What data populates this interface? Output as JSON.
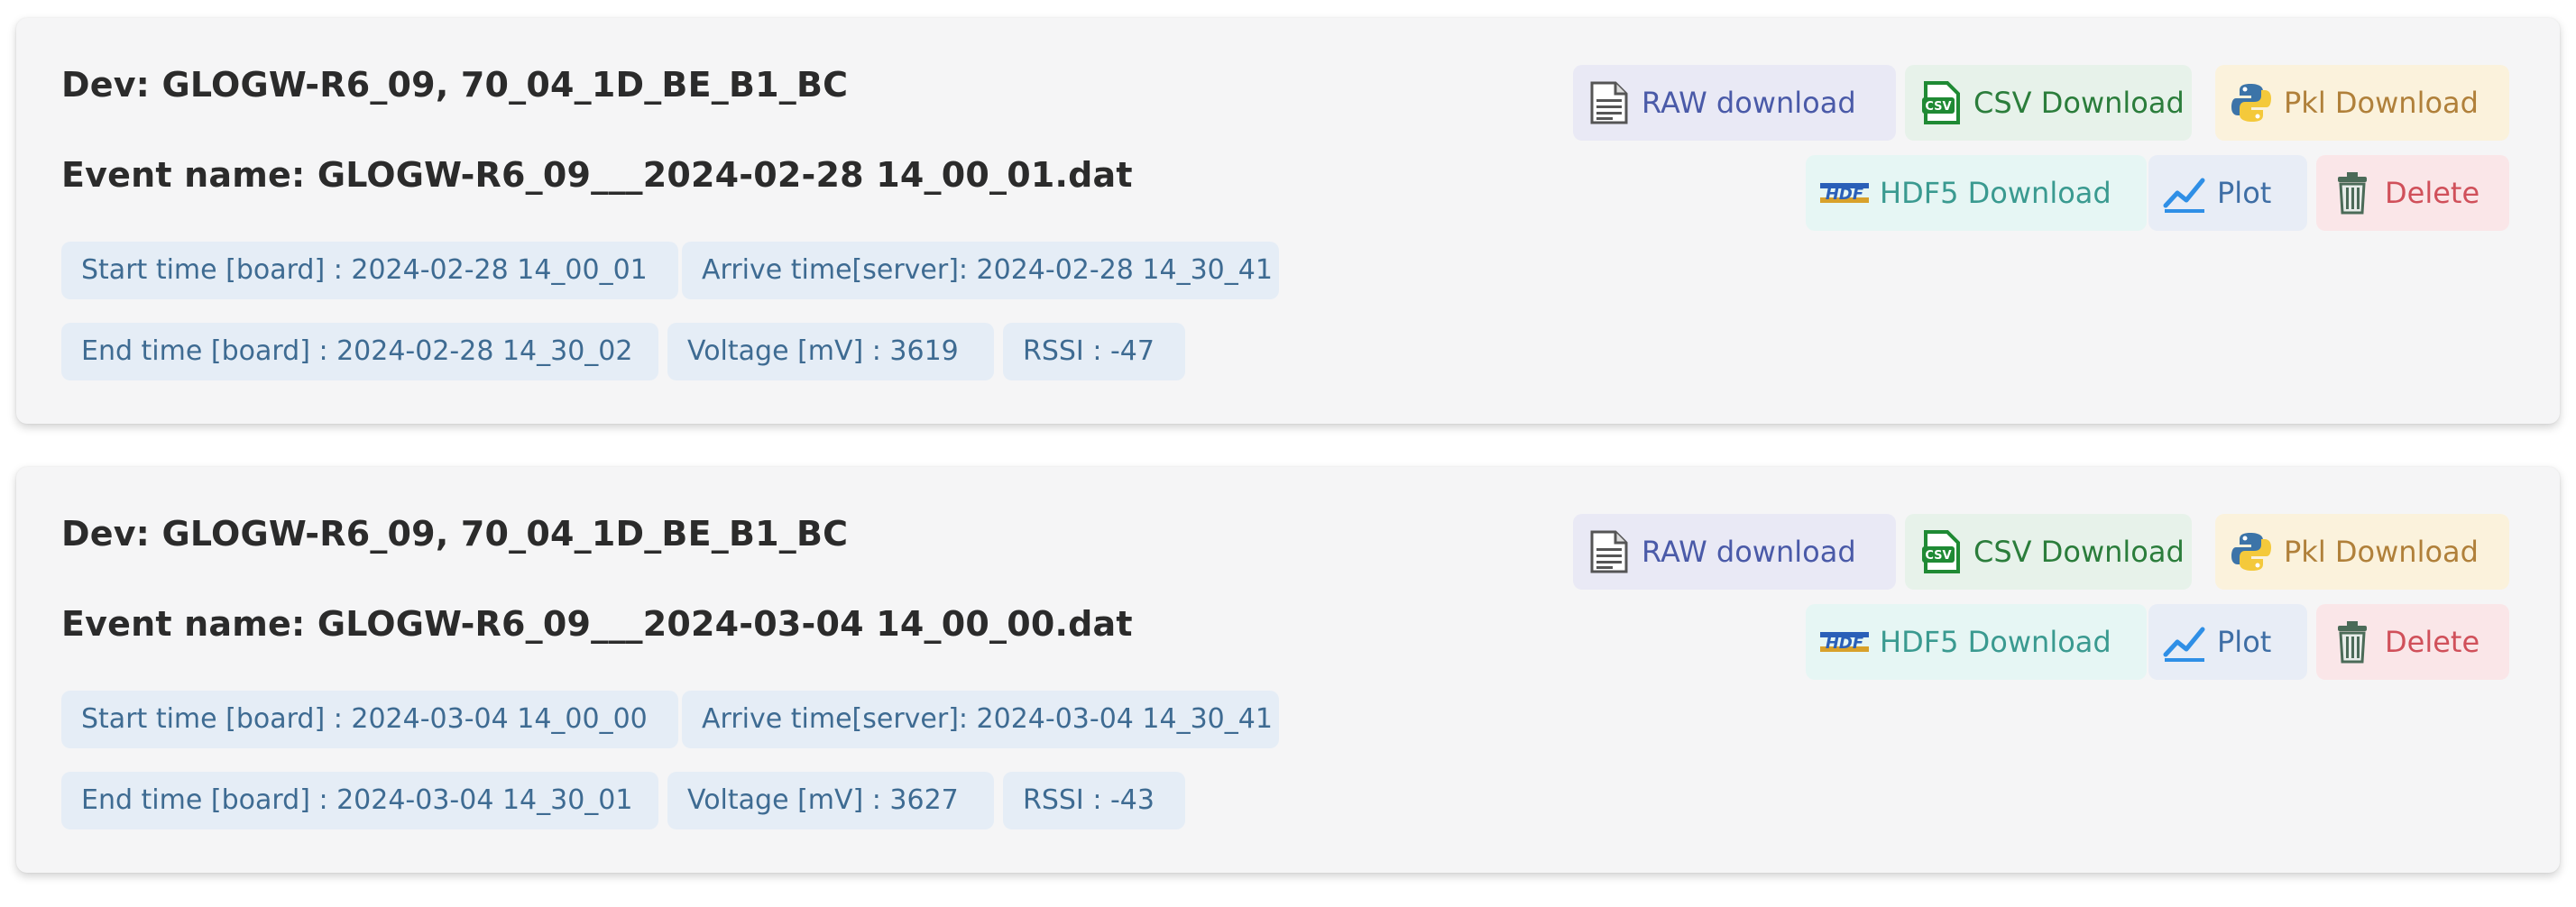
{
  "buttons": {
    "raw": "RAW download",
    "csv": "CSV Download",
    "pkl": "Pkl Download",
    "hdf5": "HDF5 Download",
    "plot": "Plot",
    "delete": "Delete"
  },
  "icons": {
    "raw": "document-icon",
    "csv": "csv-file-icon",
    "pkl": "python-icon",
    "hdf5": "hdf-icon",
    "plot": "line-chart-icon",
    "delete": "trash-icon"
  },
  "colors": {
    "card_bg": "#f5f5f6",
    "tag_bg": "#e5edf6",
    "tag_text": "#3e6b92",
    "raw": "#4a5aa8",
    "csv": "#2b7d3b",
    "pkl": "#b0803a",
    "hdf5": "#3a9a90",
    "plot": "#3e6ea5",
    "delete": "#d0505a"
  },
  "events": [
    {
      "dev": "Dev: GLOGW-R6_09, 70_04_1D_BE_B1_BC",
      "event_name": "Event name: GLOGW-R6_09___2024-02-28 14_00_01.dat",
      "start_time": "Start time [board] : 2024-02-28 14_00_01",
      "arrive_time": "Arrive time[server]: 2024-02-28 14_30_41",
      "end_time": "End time [board] : 2024-02-28 14_30_02",
      "voltage": "Voltage [mV] : 3619",
      "rssi": "RSSI : -47"
    },
    {
      "dev": "Dev: GLOGW-R6_09, 70_04_1D_BE_B1_BC",
      "event_name": "Event name: GLOGW-R6_09___2024-03-04 14_00_00.dat",
      "start_time": "Start time [board] : 2024-03-04 14_00_00",
      "arrive_time": "Arrive time[server]: 2024-03-04 14_30_41",
      "end_time": "End time [board] : 2024-03-04 14_30_01",
      "voltage": "Voltage [mV] : 3627",
      "rssi": "RSSI : -43"
    }
  ]
}
